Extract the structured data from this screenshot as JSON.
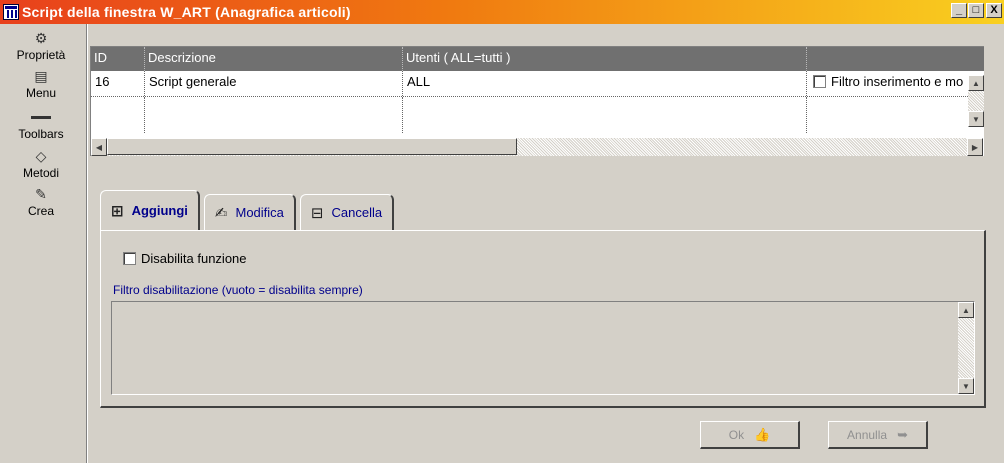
{
  "window": {
    "title": "Script della finestra W_ART  (Anagrafica articoli)",
    "minimize": "_",
    "maximize": "□",
    "close": "X"
  },
  "sidebar": {
    "items": [
      {
        "label": "Proprietà",
        "icon": "properties-icon"
      },
      {
        "label": "Menu",
        "icon": "menu-icon"
      },
      {
        "label": "Toolbars",
        "icon": "toolbars-icon"
      },
      {
        "label": "Metodi",
        "icon": "methods-icon"
      },
      {
        "label": "Crea",
        "icon": "create-icon"
      }
    ]
  },
  "grid": {
    "columns": [
      "ID",
      "Descrizione",
      "Utenti ( ALL=tutti )",
      ""
    ],
    "rows": [
      {
        "id": "16",
        "description": "Script generale",
        "users": "ALL",
        "filter_label": "Filtro inserimento e mo"
      }
    ]
  },
  "tabs": [
    {
      "label": "Aggiungi",
      "icon": "add-icon",
      "active": true
    },
    {
      "label": "Modifica",
      "icon": "edit-icon",
      "active": false
    },
    {
      "label": "Cancella",
      "icon": "delete-icon",
      "active": false
    }
  ],
  "panel": {
    "disable_label": "Disabilita funzione",
    "filter_label": "Filtro disabilitazione (vuoto = disabilita sempre)"
  },
  "buttons": {
    "ok": "Ok",
    "cancel": "Annulla"
  },
  "colors": {
    "title_gradient_start": "#e8401c",
    "title_gradient_end": "#f9d020",
    "header_bg": "#707070",
    "accent_text": "#00008b"
  }
}
